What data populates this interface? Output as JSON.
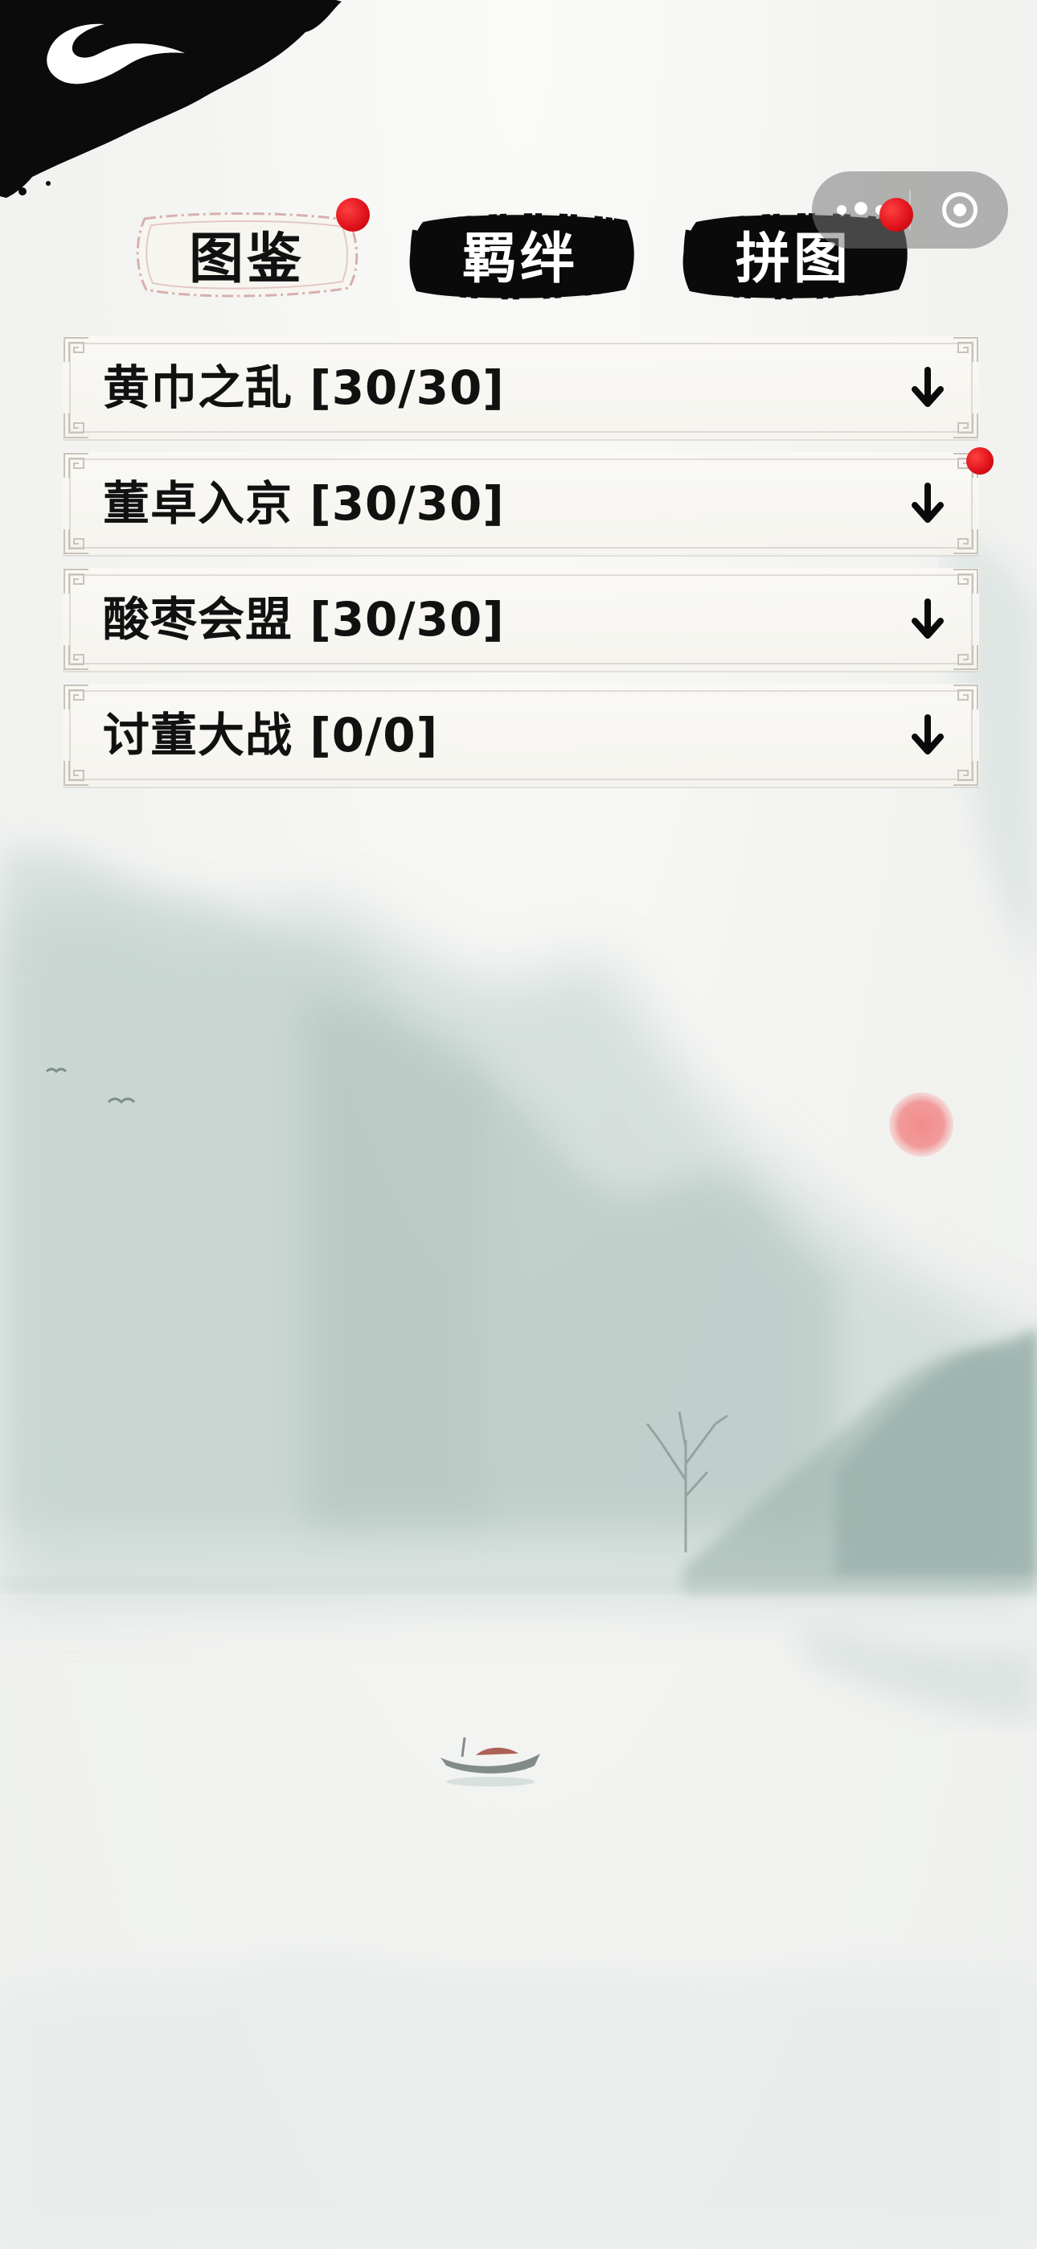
{
  "tabs": [
    {
      "label": "图鉴",
      "active": true,
      "badge": true
    },
    {
      "label": "羁绊",
      "active": false,
      "badge": false
    },
    {
      "label": "拼图",
      "active": false,
      "badge": true
    }
  ],
  "chapters": [
    {
      "label": "黄巾之乱 [30/30]",
      "badge": false
    },
    {
      "label": "董卓入京 [30/30]",
      "badge": true
    },
    {
      "label": "酸枣会盟 [30/30]",
      "badge": false
    },
    {
      "label": "讨董大战 [0/0]",
      "badge": false
    }
  ],
  "icons": {
    "back": "back-logo-icon",
    "more": "more-dots-icon",
    "close": "close-target-icon",
    "expand": "arrow-down-icon"
  },
  "colors": {
    "ink": "#111111",
    "badge_red": "#e0141c",
    "sun_red": "#f08a8a",
    "mountain": "#b9cbc5"
  }
}
